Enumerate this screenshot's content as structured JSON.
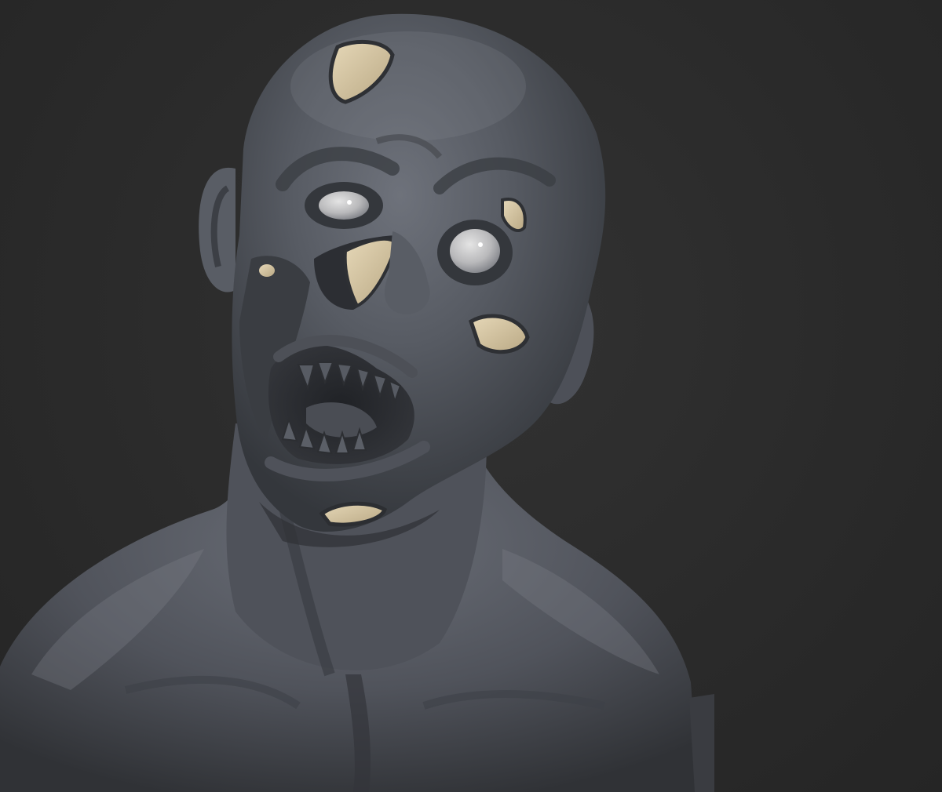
{
  "scene": {
    "subject": "sculpted-zombie-bust",
    "background_color": "#2b2b2b",
    "clay_color": "#5a5e66",
    "bone_color": "#d8c9a8",
    "eye_color": "#c9c9c9"
  }
}
